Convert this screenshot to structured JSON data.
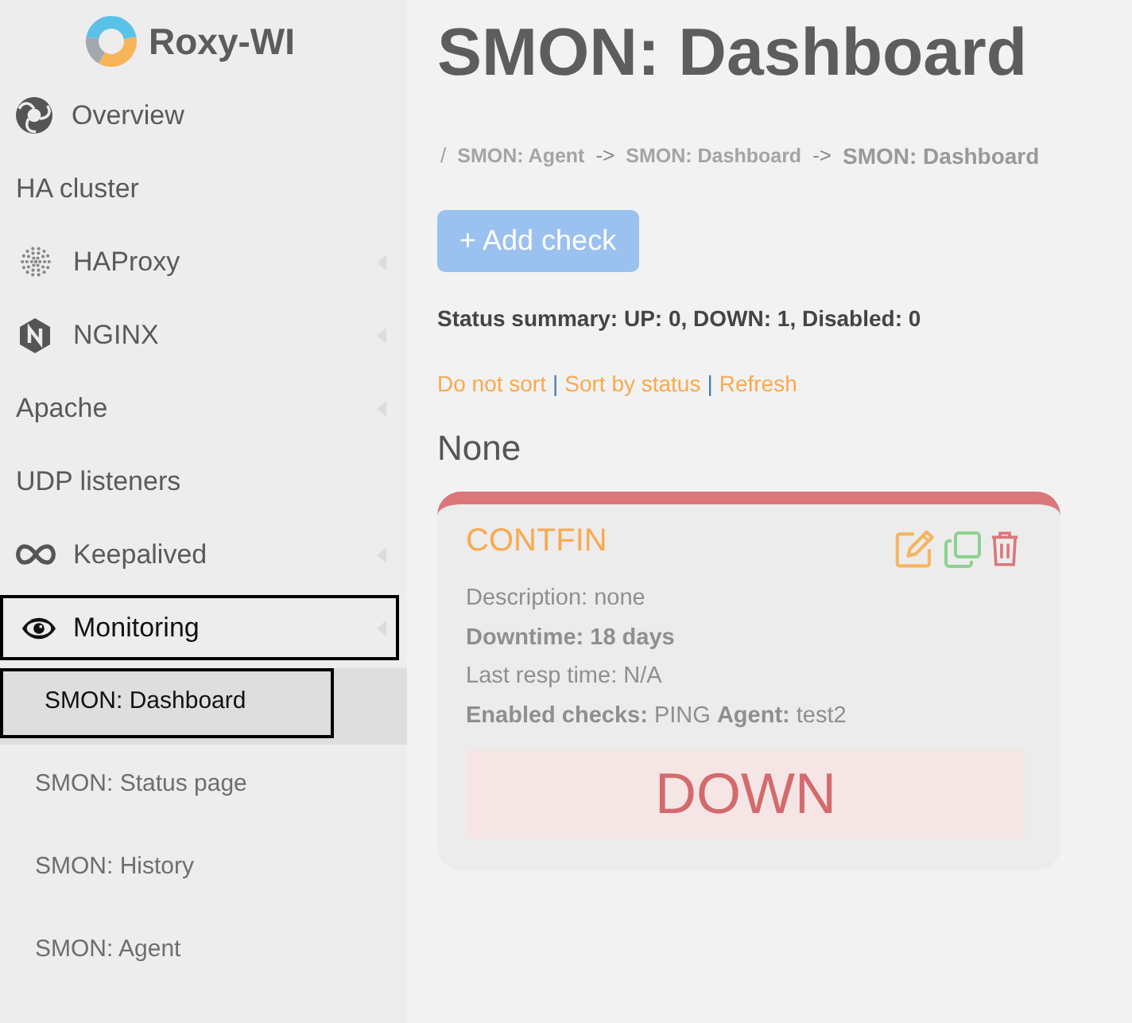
{
  "logo": {
    "text": "Roxy-WI"
  },
  "sidebar": {
    "items": [
      {
        "label": "Overview",
        "expandable": false,
        "expanded": false,
        "outlined": false
      },
      {
        "label": "HA cluster",
        "expandable": false,
        "expanded": false,
        "outlined": false
      },
      {
        "label": "HAProxy",
        "expandable": true,
        "expanded": false,
        "outlined": false
      },
      {
        "label": "NGINX",
        "expandable": true,
        "expanded": false,
        "outlined": false
      },
      {
        "label": "Apache",
        "expandable": true,
        "expanded": false,
        "outlined": false
      },
      {
        "label": "UDP listeners",
        "expandable": false,
        "expanded": false,
        "outlined": false
      },
      {
        "label": "Keepalived",
        "expandable": true,
        "expanded": false,
        "outlined": false
      },
      {
        "label": "Monitoring",
        "expandable": true,
        "expanded": true,
        "outlined": true,
        "children": [
          {
            "label": "SMON: Dashboard",
            "selected": true,
            "outlined": true
          },
          {
            "label": "SMON: Status page",
            "selected": false,
            "outlined": false
          },
          {
            "label": "SMON: History",
            "selected": false,
            "outlined": false
          },
          {
            "label": "SMON: Agent",
            "selected": false,
            "outlined": false
          }
        ]
      }
    ]
  },
  "page": {
    "title": "SMON: Dashboard",
    "breadcrumb": [
      {
        "kind": "root",
        "text": "/"
      },
      {
        "kind": "link",
        "text": "SMON: Agent"
      },
      {
        "kind": "arrow",
        "text": "->"
      },
      {
        "kind": "link",
        "text": "SMON: Dashboard"
      },
      {
        "kind": "arrow",
        "text": "->"
      },
      {
        "kind": "current",
        "text": "SMON: Dashboard"
      }
    ],
    "add_button": "+ Add check",
    "status_summary": "Status summary: UP: 0, DOWN: 1, Disabled: 0",
    "sort_links": [
      {
        "kind": "link",
        "text": "Do not sort"
      },
      {
        "kind": "separator",
        "text": "|"
      },
      {
        "kind": "link",
        "text": "Sort by status"
      },
      {
        "kind": "separator",
        "text": "|"
      },
      {
        "kind": "link",
        "text": "Refresh"
      }
    ],
    "group_title": "None",
    "checks": [
      {
        "kind": "down",
        "name": "CONTFIN",
        "status_label": "DOWN",
        "lines": [
          {
            "text": "Description: none",
            "bold": false
          },
          {
            "text": "Downtime: 18 days",
            "bold": true
          },
          {
            "text": "Last resp time: N/A",
            "bold": false
          },
          {
            "text": "**Enabled checks:** PING **Agent:** test2",
            "bold": false
          }
        ]
      }
    ]
  }
}
